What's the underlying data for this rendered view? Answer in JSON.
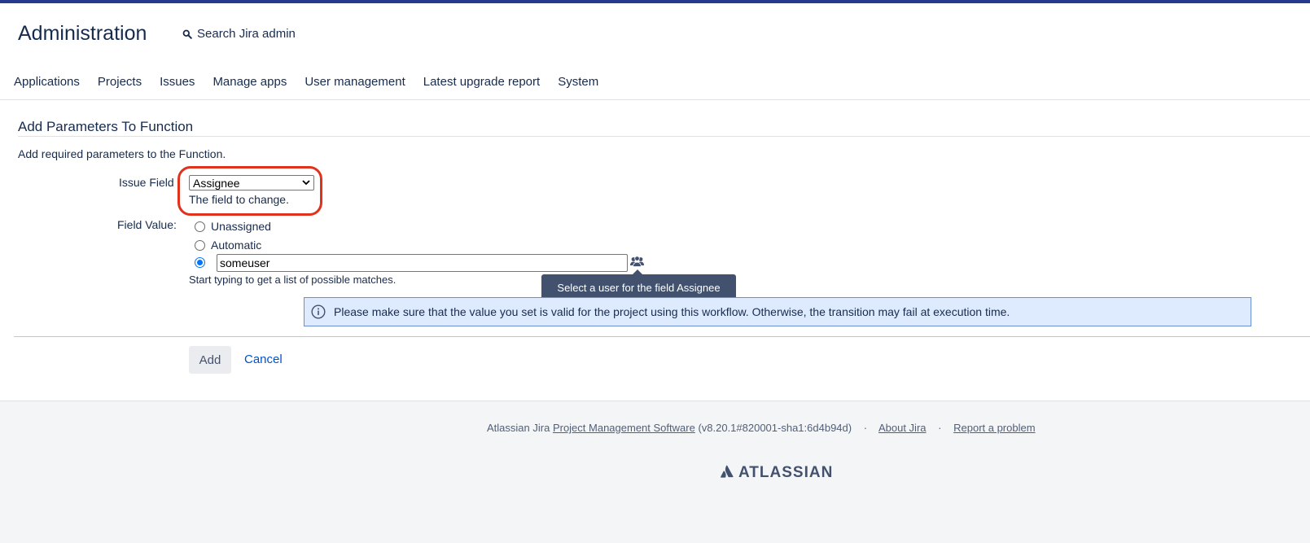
{
  "header": {
    "title": "Administration",
    "search_label": "Search Jira admin"
  },
  "nav": {
    "items": [
      {
        "label": "Applications"
      },
      {
        "label": "Projects"
      },
      {
        "label": "Issues"
      },
      {
        "label": "Manage apps"
      },
      {
        "label": "User management"
      },
      {
        "label": "Latest upgrade report"
      },
      {
        "label": "System"
      }
    ]
  },
  "form": {
    "title": "Add Parameters To Function",
    "description": "Add required parameters to the Function.",
    "issue_field": {
      "label": "Issue Field",
      "selected": "Assignee",
      "help": "The field to change."
    },
    "field_value": {
      "label": "Field Value:",
      "options": [
        {
          "label": "Unassigned",
          "checked": false
        },
        {
          "label": "Automatic",
          "checked": false
        },
        {
          "label": "",
          "checked": true
        }
      ],
      "user_value": "someuser",
      "help": "Start typing to get a list of possible matches."
    },
    "tooltip": "Select a user for the field Assignee",
    "info_message": "Please make sure that the value you set is valid for the project using this workflow. Otherwise, the transition may fail at execution time.",
    "add_label": "Add",
    "cancel_label": "Cancel"
  },
  "footer": {
    "prefix": "Atlassian Jira",
    "product_link": "Project Management Software",
    "version": "(v8.20.1#820001-sha1:6d4b94d)",
    "about_link": "About Jira",
    "report_link": "Report a problem",
    "separator": "·",
    "logo_text": "ATLASSIAN"
  },
  "colors": {
    "accent_bar": "#253a8f",
    "highlight": "#e0331e",
    "link": "#0052cc",
    "info_bg": "#deebff",
    "tooltip_bg": "#42526e"
  }
}
